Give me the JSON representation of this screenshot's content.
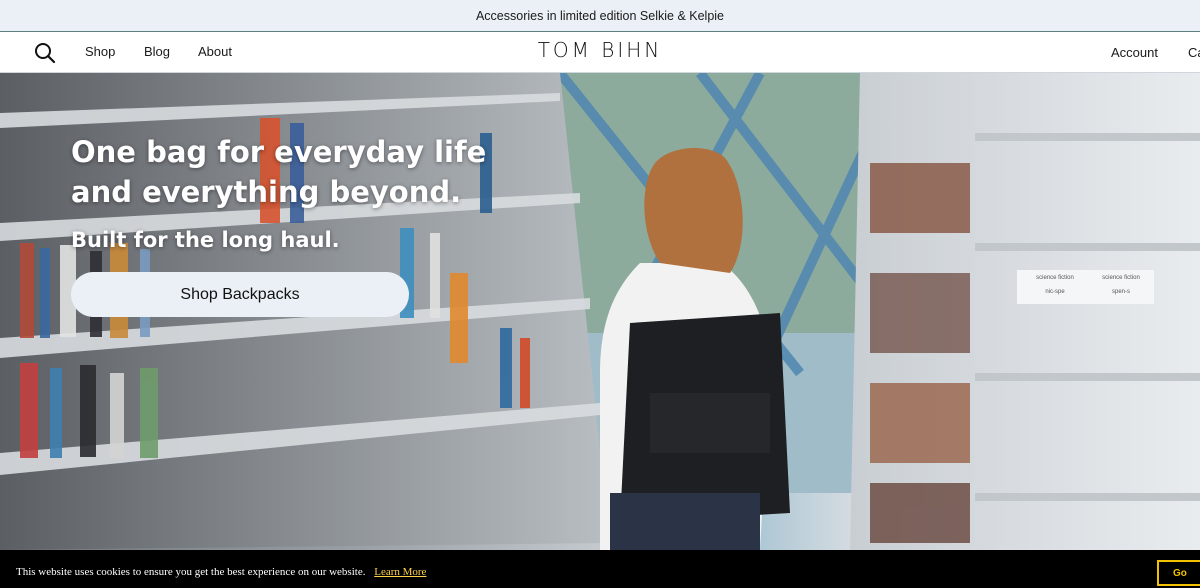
{
  "announcement": {
    "text": "Accessories in limited edition Selkie & Kelpie"
  },
  "header": {
    "nav": [
      {
        "label": "Shop"
      },
      {
        "label": "Blog"
      },
      {
        "label": "About"
      }
    ],
    "logo": "TOM BIHN",
    "account_label": "Account",
    "cart_label": "Ca"
  },
  "hero": {
    "title_line1": "One bag for everyday life",
    "title_line2": "and everything beyond.",
    "subtitle": "Built for the long haul.",
    "cta_label": "Shop Backpacks",
    "shelf_labels": [
      {
        "top": "science fiction",
        "bottom": "nic-spe"
      },
      {
        "top": "science fiction",
        "bottom": "spen-s"
      }
    ]
  },
  "cookie_banner": {
    "message": "This website uses cookies to ensure you get the best experience on our website.",
    "learn_more": "Learn More",
    "button_label": "Go"
  },
  "colors": {
    "announcement_bg": "#eaf0f6",
    "cookie_bg": "#000000",
    "cookie_accent": "#f2c200"
  }
}
